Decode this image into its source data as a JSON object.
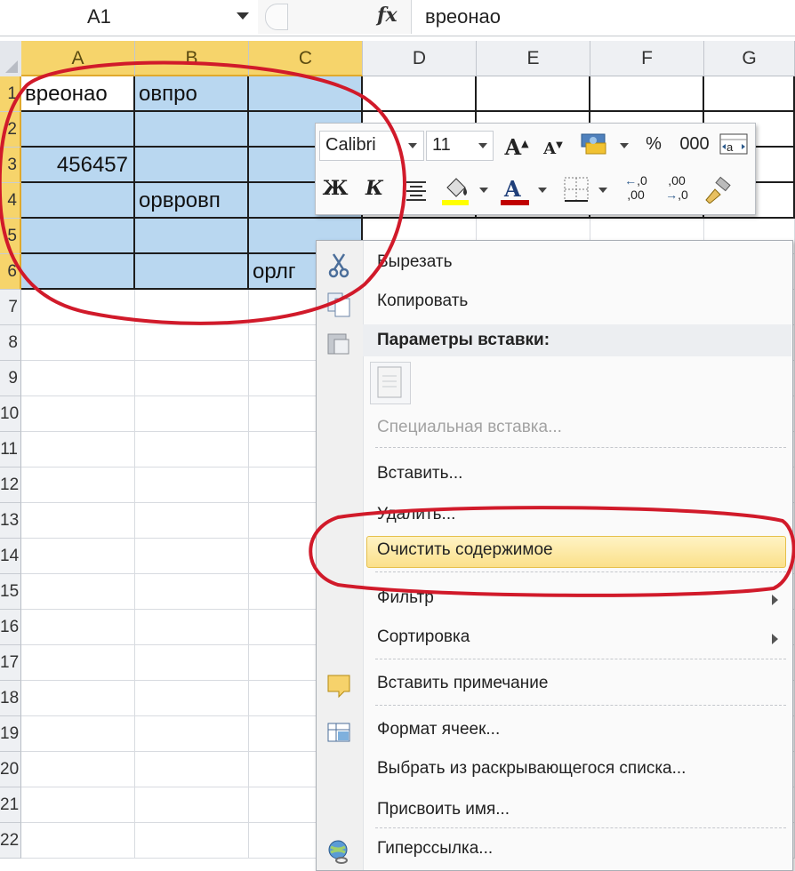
{
  "formula_bar": {
    "name_box": "A1",
    "fx_icon": "fx-icon",
    "content": "вреонао"
  },
  "columns": [
    "A",
    "B",
    "C",
    "D",
    "E",
    "F",
    "G"
  ],
  "rows": [
    "1",
    "2",
    "3",
    "4",
    "5",
    "6",
    "7",
    "8",
    "9",
    "10",
    "11",
    "12",
    "13",
    "14",
    "15",
    "16",
    "17",
    "18",
    "19",
    "20",
    "21",
    "22"
  ],
  "cells": {
    "A1": "вреонао",
    "B1": "овпро",
    "A3": "456457",
    "B4": "орвровп",
    "C6": "орлг"
  },
  "mini_toolbar": {
    "font_name": "Calibri",
    "font_size": "11",
    "grow_font_icon": "grow-font-icon",
    "shrink_font_icon": "shrink-font-icon",
    "accounting_format_icon": "accounting-format-icon",
    "percent": "%",
    "thousands": "000",
    "merge_icon": "merge-center-icon",
    "bold": "Ж",
    "italic": "К",
    "align_icon": "align-center-icon",
    "fill_color_icon": "fill-color-icon",
    "font_color_icon": "font-color-icon",
    "borders_icon": "borders-icon",
    "increase_decimal": "increase-decimal-icon",
    "decrease_decimal": "decrease-decimal-icon",
    "format_painter_icon": "format-painter-icon",
    "fill_color": "#ffff00",
    "font_color": "#c00000"
  },
  "context_menu": {
    "cut": "Вырезать",
    "copy": "Копировать",
    "paste_options": "Параметры вставки:",
    "paste_special": "Специальная вставка...",
    "insert": "Вставить...",
    "delete": "Удалить...",
    "clear_contents": "Очистить содержимое",
    "filter": "Фильтр",
    "sort": "Сортировка",
    "insert_comment": "Вставить примечание",
    "format_cells": "Формат ячеек...",
    "pick_from_list": "Выбрать из раскрывающегося списка...",
    "define_name": "Присвоить имя...",
    "hyperlink": "Гиперссылка..."
  },
  "colors": {
    "selection_fill": "#b9d7f0",
    "header_selected": "#f6d46b",
    "highlight": "#fbe08a",
    "annotation_red": "#d11a2a"
  }
}
